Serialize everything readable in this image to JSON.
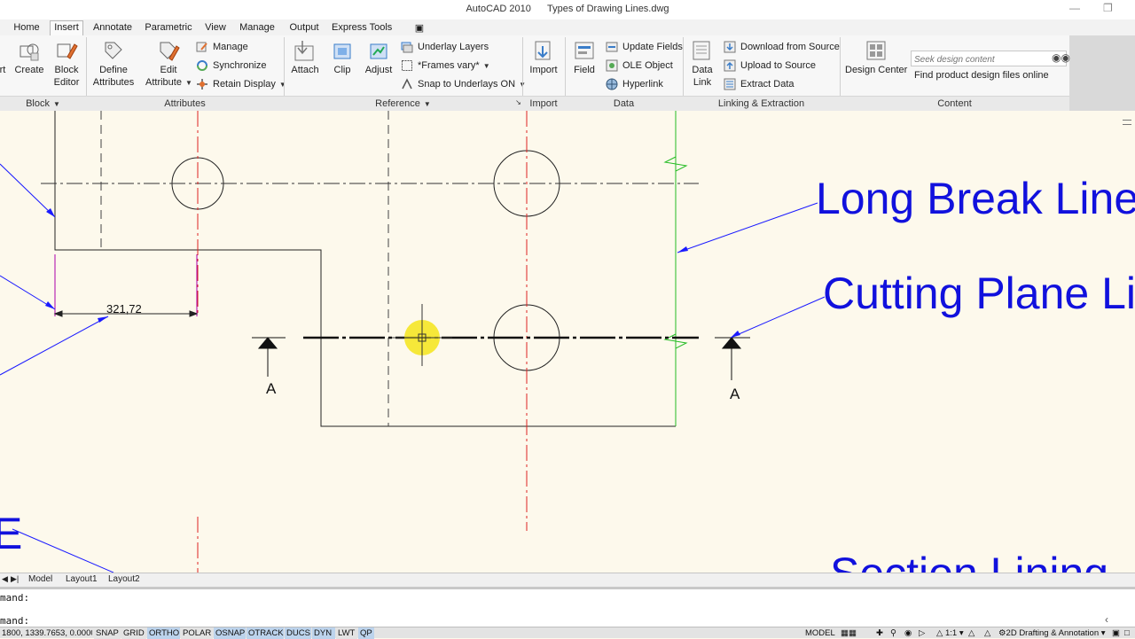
{
  "window": {
    "title": "AutoCAD 2010      Types of Drawing Lines.dwg"
  },
  "tabs": [
    "Home",
    "Insert",
    "Annotate",
    "Parametric",
    "View",
    "Manage",
    "Output",
    "Express Tools"
  ],
  "active_tab": "Insert",
  "ribbon": {
    "block": {
      "title": "Block",
      "insert": "rt",
      "create": "Create",
      "editor_l1": "Block",
      "editor_l2": "Editor"
    },
    "attributes": {
      "title": "Attributes",
      "define_l1": "Define",
      "define_l2": "Attributes",
      "edit_l1": "Edit",
      "edit_l2": "Attribute",
      "manage": "Manage",
      "synchronize": "Synchronize",
      "retain": "Retain Display"
    },
    "reference": {
      "title": "Reference",
      "attach": "Attach",
      "clip": "Clip",
      "adjust": "Adjust",
      "underlay_layers": "Underlay Layers",
      "frames": "*Frames vary*",
      "snap": "Snap to Underlays ON"
    },
    "import": {
      "title": "Import",
      "import": "Import"
    },
    "data": {
      "title": "Data",
      "field": "Field",
      "update_fields": "Update Fields",
      "ole": "OLE Object",
      "hyperlink": "Hyperlink"
    },
    "linking": {
      "title": "Linking & Extraction",
      "data_link_l1": "Data",
      "data_link_l2": "Link",
      "download": "Download from Source",
      "upload": "Upload to Source",
      "extract": "Extract  Data"
    },
    "content": {
      "title": "Content",
      "design_center": "Design Center",
      "search_placeholder": "Seek design content",
      "find": "Find product design files online"
    }
  },
  "drawing": {
    "dimension": "321,72",
    "section_label_left": "A",
    "section_label_right": "A",
    "label_long_break": "Long Break Line",
    "label_cutting_plane": "Cutting Plane Line",
    "label_section_lining": "Section Lining",
    "label_left_fragment": "E"
  },
  "layout_tabs": [
    "Model",
    "Layout1",
    "Layout2"
  ],
  "command": {
    "line1": "mand:",
    "line2": "mand:"
  },
  "status": {
    "coords": "1800, 1339.7653, 0.0000",
    "toggles": [
      {
        "label": "SNAP",
        "on": false
      },
      {
        "label": "GRID",
        "on": false
      },
      {
        "label": "ORTHO",
        "on": true
      },
      {
        "label": "POLAR",
        "on": false
      },
      {
        "label": "OSNAP",
        "on": true
      },
      {
        "label": "OTRACK",
        "on": true
      },
      {
        "label": "DUCS",
        "on": true
      },
      {
        "label": "DYN",
        "on": true
      },
      {
        "label": "LWT",
        "on": false
      },
      {
        "label": "QP",
        "on": true
      }
    ],
    "model": "MODEL",
    "scale": "1:1",
    "workspace": "2D Drafting & Annotation"
  },
  "colors": {
    "label_blue": "#1111dd",
    "centerline_red": "#dd2222",
    "break_green": "#22bb22",
    "leader_blue": "#1a1aff",
    "highlight_yellow": "#f5e51a"
  }
}
